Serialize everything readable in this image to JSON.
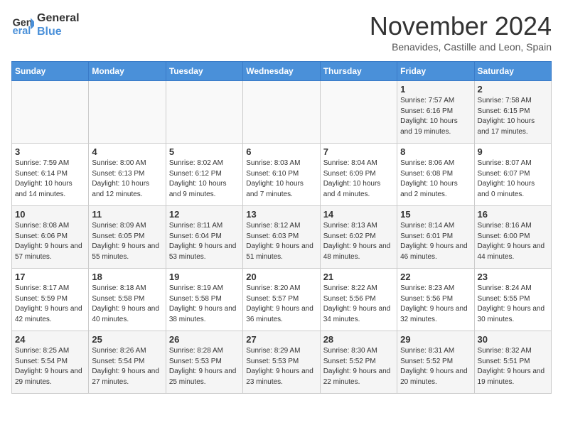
{
  "header": {
    "logo_line1": "General",
    "logo_line2": "Blue",
    "month": "November 2024",
    "location": "Benavides, Castille and Leon, Spain"
  },
  "weekdays": [
    "Sunday",
    "Monday",
    "Tuesday",
    "Wednesday",
    "Thursday",
    "Friday",
    "Saturday"
  ],
  "weeks": [
    [
      {
        "day": "",
        "info": ""
      },
      {
        "day": "",
        "info": ""
      },
      {
        "day": "",
        "info": ""
      },
      {
        "day": "",
        "info": ""
      },
      {
        "day": "",
        "info": ""
      },
      {
        "day": "1",
        "info": "Sunrise: 7:57 AM\nSunset: 6:16 PM\nDaylight: 10 hours and 19 minutes."
      },
      {
        "day": "2",
        "info": "Sunrise: 7:58 AM\nSunset: 6:15 PM\nDaylight: 10 hours and 17 minutes."
      }
    ],
    [
      {
        "day": "3",
        "info": "Sunrise: 7:59 AM\nSunset: 6:14 PM\nDaylight: 10 hours and 14 minutes."
      },
      {
        "day": "4",
        "info": "Sunrise: 8:00 AM\nSunset: 6:13 PM\nDaylight: 10 hours and 12 minutes."
      },
      {
        "day": "5",
        "info": "Sunrise: 8:02 AM\nSunset: 6:12 PM\nDaylight: 10 hours and 9 minutes."
      },
      {
        "day": "6",
        "info": "Sunrise: 8:03 AM\nSunset: 6:10 PM\nDaylight: 10 hours and 7 minutes."
      },
      {
        "day": "7",
        "info": "Sunrise: 8:04 AM\nSunset: 6:09 PM\nDaylight: 10 hours and 4 minutes."
      },
      {
        "day": "8",
        "info": "Sunrise: 8:06 AM\nSunset: 6:08 PM\nDaylight: 10 hours and 2 minutes."
      },
      {
        "day": "9",
        "info": "Sunrise: 8:07 AM\nSunset: 6:07 PM\nDaylight: 10 hours and 0 minutes."
      }
    ],
    [
      {
        "day": "10",
        "info": "Sunrise: 8:08 AM\nSunset: 6:06 PM\nDaylight: 9 hours and 57 minutes."
      },
      {
        "day": "11",
        "info": "Sunrise: 8:09 AM\nSunset: 6:05 PM\nDaylight: 9 hours and 55 minutes."
      },
      {
        "day": "12",
        "info": "Sunrise: 8:11 AM\nSunset: 6:04 PM\nDaylight: 9 hours and 53 minutes."
      },
      {
        "day": "13",
        "info": "Sunrise: 8:12 AM\nSunset: 6:03 PM\nDaylight: 9 hours and 51 minutes."
      },
      {
        "day": "14",
        "info": "Sunrise: 8:13 AM\nSunset: 6:02 PM\nDaylight: 9 hours and 48 minutes."
      },
      {
        "day": "15",
        "info": "Sunrise: 8:14 AM\nSunset: 6:01 PM\nDaylight: 9 hours and 46 minutes."
      },
      {
        "day": "16",
        "info": "Sunrise: 8:16 AM\nSunset: 6:00 PM\nDaylight: 9 hours and 44 minutes."
      }
    ],
    [
      {
        "day": "17",
        "info": "Sunrise: 8:17 AM\nSunset: 5:59 PM\nDaylight: 9 hours and 42 minutes."
      },
      {
        "day": "18",
        "info": "Sunrise: 8:18 AM\nSunset: 5:58 PM\nDaylight: 9 hours and 40 minutes."
      },
      {
        "day": "19",
        "info": "Sunrise: 8:19 AM\nSunset: 5:58 PM\nDaylight: 9 hours and 38 minutes."
      },
      {
        "day": "20",
        "info": "Sunrise: 8:20 AM\nSunset: 5:57 PM\nDaylight: 9 hours and 36 minutes."
      },
      {
        "day": "21",
        "info": "Sunrise: 8:22 AM\nSunset: 5:56 PM\nDaylight: 9 hours and 34 minutes."
      },
      {
        "day": "22",
        "info": "Sunrise: 8:23 AM\nSunset: 5:56 PM\nDaylight: 9 hours and 32 minutes."
      },
      {
        "day": "23",
        "info": "Sunrise: 8:24 AM\nSunset: 5:55 PM\nDaylight: 9 hours and 30 minutes."
      }
    ],
    [
      {
        "day": "24",
        "info": "Sunrise: 8:25 AM\nSunset: 5:54 PM\nDaylight: 9 hours and 29 minutes."
      },
      {
        "day": "25",
        "info": "Sunrise: 8:26 AM\nSunset: 5:54 PM\nDaylight: 9 hours and 27 minutes."
      },
      {
        "day": "26",
        "info": "Sunrise: 8:28 AM\nSunset: 5:53 PM\nDaylight: 9 hours and 25 minutes."
      },
      {
        "day": "27",
        "info": "Sunrise: 8:29 AM\nSunset: 5:53 PM\nDaylight: 9 hours and 23 minutes."
      },
      {
        "day": "28",
        "info": "Sunrise: 8:30 AM\nSunset: 5:52 PM\nDaylight: 9 hours and 22 minutes."
      },
      {
        "day": "29",
        "info": "Sunrise: 8:31 AM\nSunset: 5:52 PM\nDaylight: 9 hours and 20 minutes."
      },
      {
        "day": "30",
        "info": "Sunrise: 8:32 AM\nSunset: 5:51 PM\nDaylight: 9 hours and 19 minutes."
      }
    ]
  ]
}
